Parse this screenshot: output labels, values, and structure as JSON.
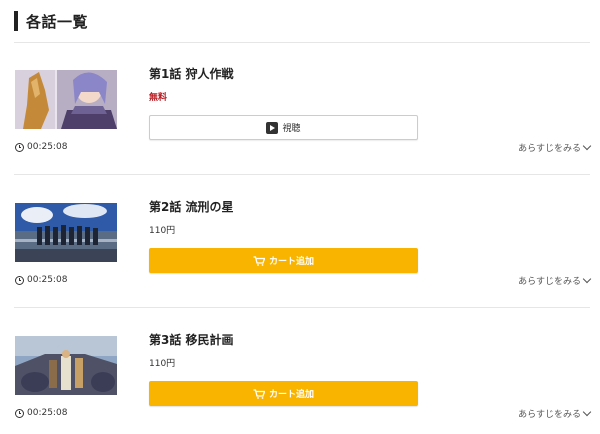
{
  "section": {
    "title": "各話一覧"
  },
  "episodes": [
    {
      "title": "第1話 狩人作戦",
      "price": "無料",
      "action": "視聴",
      "action_type": "watch",
      "duration": "00:25:08",
      "synopsis_link": "あらすじをみる"
    },
    {
      "title": "第2話 流刑の星",
      "price": "110円",
      "action": "カート追加",
      "action_type": "cart",
      "duration": "00:25:08",
      "synopsis_link": "あらすじをみる"
    },
    {
      "title": "第3話 移民計画",
      "price": "110円",
      "action": "カート追加",
      "action_type": "cart",
      "duration": "00:25:08",
      "synopsis_link": "あらすじをみる"
    }
  ],
  "colors": {
    "cart_button": "#f9b400",
    "free_price": "#b81c22"
  },
  "icons": {
    "watch": "play-icon",
    "cart": "cart-icon",
    "duration": "clock-icon",
    "synopsis": "chevron-down-icon"
  }
}
